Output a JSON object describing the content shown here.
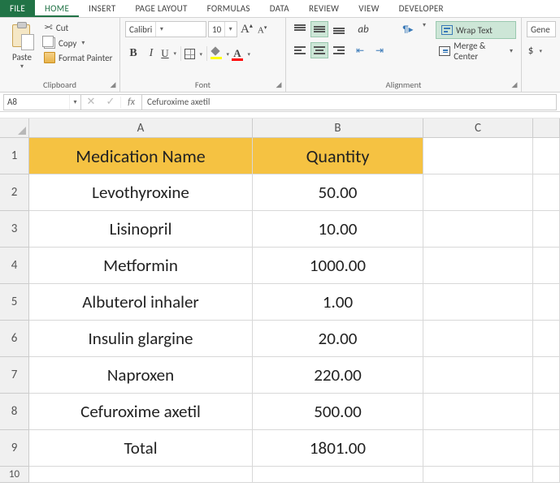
{
  "tabs": {
    "file": "FILE",
    "home": "HOME",
    "insert": "INSERT",
    "pagelayout": "PAGE LAYOUT",
    "formulas": "FORMULAS",
    "data": "DATA",
    "review": "REVIEW",
    "view": "VIEW",
    "developer": "DEVELOPER"
  },
  "ribbon": {
    "clipboard": {
      "paste": "Paste",
      "cut": "Cut",
      "copy": "Copy",
      "formatpainter": "Format Painter",
      "label": "Clipboard"
    },
    "font": {
      "name": "Calibri",
      "size": "10",
      "label": "Font"
    },
    "alignment": {
      "wrap": "Wrap Text",
      "merge": "Merge & Center",
      "label": "Alignment"
    },
    "number": {
      "format": "Gene",
      "currency": "$"
    }
  },
  "formula_bar": {
    "name_box": "A8",
    "fx": "fx",
    "value": "Cefuroxime axetil"
  },
  "columns": {
    "A": "A",
    "B": "B",
    "C": "C"
  },
  "rows": [
    "1",
    "2",
    "3",
    "4",
    "5",
    "6",
    "7",
    "8",
    "9",
    "10"
  ],
  "sheet": {
    "header": {
      "A": "Medication Name",
      "B": "Quantity"
    },
    "data": [
      {
        "A": "Levothyroxine",
        "B": "50.00"
      },
      {
        "A": "Lisinopril",
        "B": "10.00"
      },
      {
        "A": "Metformin",
        "B": "1000.00"
      },
      {
        "A": "Albuterol inhaler",
        "B": "1.00"
      },
      {
        "A": "Insulin glargine",
        "B": "20.00"
      },
      {
        "A": "Naproxen",
        "B": "220.00"
      },
      {
        "A": "Cefuroxime axetil",
        "B": "500.00"
      },
      {
        "A": "Total",
        "B": "1801.00"
      }
    ]
  }
}
